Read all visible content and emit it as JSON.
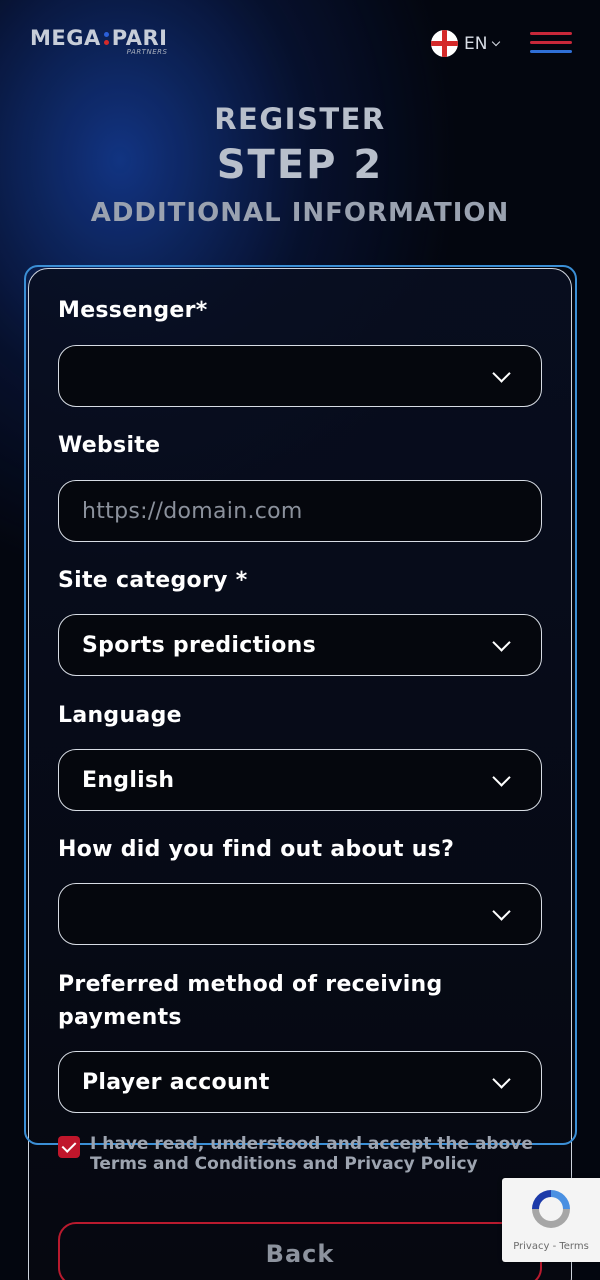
{
  "header": {
    "logo_left": "MEGA",
    "logo_right": "PARI",
    "logo_sub": "PARTNERS",
    "language": "EN",
    "colors": {
      "logo_dot_blue": "#2b5fd9",
      "logo_dot_red": "#d42a2a",
      "menu_red": "#c8283a",
      "menu_blue": "#2f6fd6"
    }
  },
  "titles": {
    "register": "REGISTER",
    "step": "STEP 2",
    "subtitle": "ADDITIONAL INFORMATION"
  },
  "form": {
    "messenger": {
      "label": "Messenger*",
      "value": ""
    },
    "website": {
      "label": "Website",
      "placeholder": "https://domain.com",
      "value": ""
    },
    "site_category": {
      "label": "Site category *",
      "value": "Sports predictions"
    },
    "language": {
      "label": "Language",
      "value": "English"
    },
    "found_us": {
      "label": "How did you find out about us?",
      "value": ""
    },
    "payment_method": {
      "label": "Preferred method of receiving payments",
      "value": "Player account"
    }
  },
  "terms": {
    "checked": true,
    "text": "I have read, understood and accept the above Terms and Conditions and Privacy Policy"
  },
  "buttons": {
    "back": "Back"
  },
  "recaptcha": {
    "text": "Privacy - Terms"
  },
  "colors": {
    "accent_blue": "#3b8fd6",
    "checkbox_red": "#c0162b",
    "back_border": "#b81a2e"
  }
}
